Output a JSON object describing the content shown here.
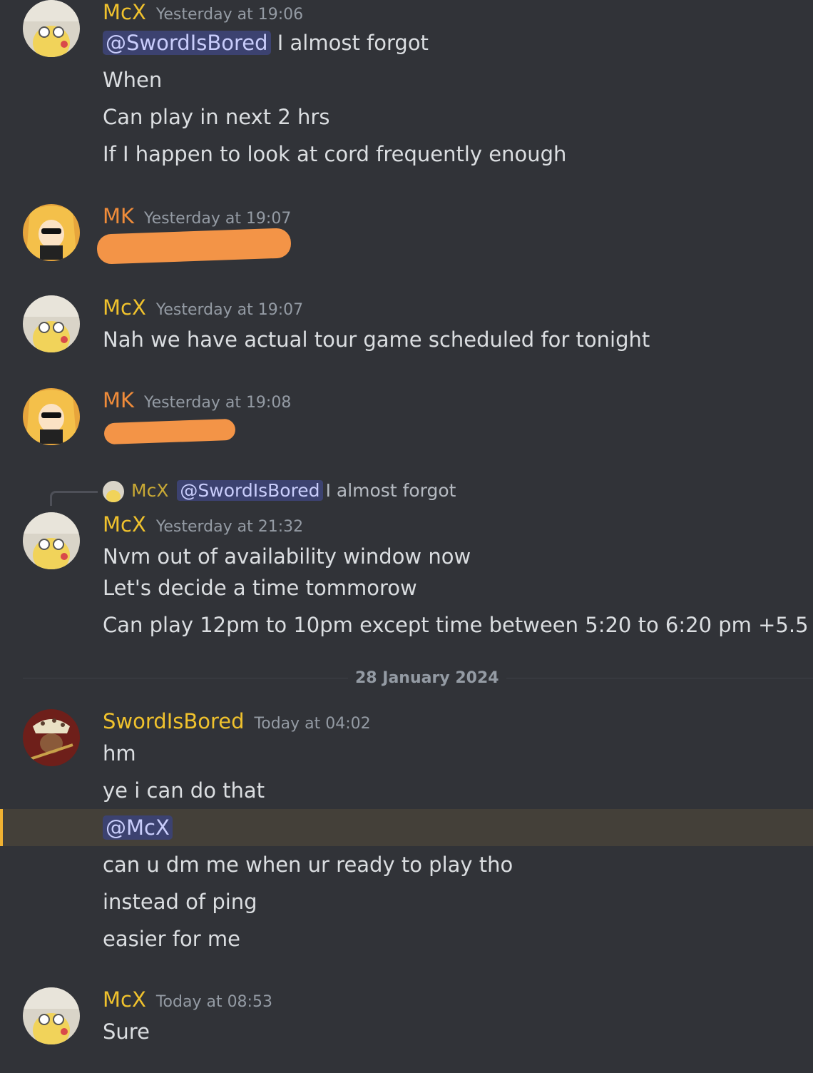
{
  "colors": {
    "mcx_name": "#f0c22d",
    "mk_name": "#f08c3a",
    "sword_name": "#f0c22d",
    "mention_bg": "#3c4270",
    "redaction": "#f39447",
    "highlight_bar": "#f0b232"
  },
  "messages": [
    {
      "author": "McX",
      "timestamp": "Yesterday at 19:06",
      "lines": [
        "I almost forgot",
        "When",
        "Can play in next 2 hrs",
        "If I happen to look at cord frequently enough"
      ],
      "mention": "@SwordIsBored"
    },
    {
      "author": "MK",
      "timestamp": "Yesterday at 19:07",
      "redacted": true
    },
    {
      "author": "McX",
      "timestamp": "Yesterday at 19:07",
      "lines": [
        "Nah we have actual tour game scheduled for tonight"
      ]
    },
    {
      "author": "MK",
      "timestamp": "Yesterday at 19:08",
      "redacted": true
    },
    {
      "reply": {
        "author": "McX",
        "mention": "@SwordIsBored",
        "text": "I almost forgot"
      },
      "author": "McX",
      "timestamp": "Yesterday at 21:32",
      "lines": [
        "Nvm out of availability window now",
        "Let's decide a time tommorow",
        "Can play 12pm to 10pm except time between 5:20 to 6:20 pm +5.5"
      ]
    },
    {
      "author": "SwordIsBored",
      "timestamp": "Today at 04:02",
      "lines": [
        "hm",
        "ye i can do that",
        "@McX",
        "can u dm me when ur ready to play tho",
        "instead of ping",
        "easier for me"
      ]
    },
    {
      "author": "McX",
      "timestamp": "Today at 08:53",
      "lines": [
        "Sure"
      ]
    }
  ],
  "date_divider": "28 January 2024"
}
